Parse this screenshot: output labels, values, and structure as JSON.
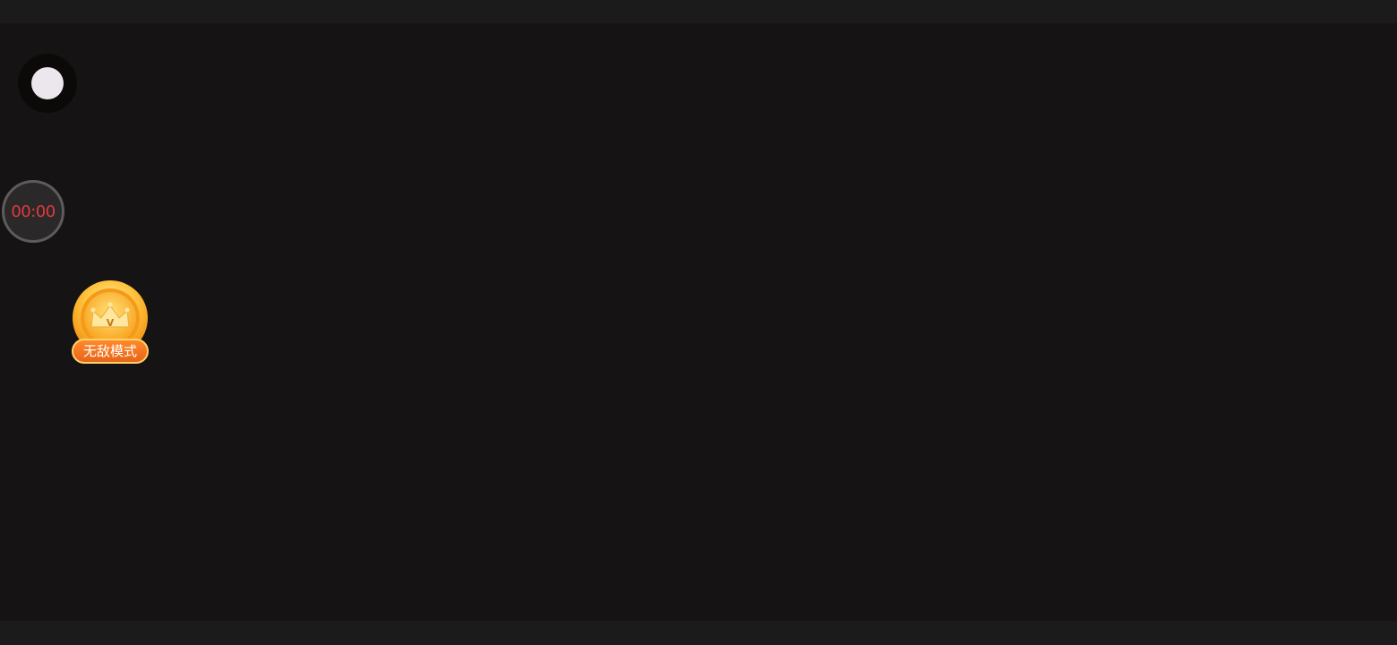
{
  "timer": {
    "value": "00:00"
  },
  "mode_badge": {
    "label": "无敌模式",
    "crown_letter": "V",
    "icon": "crown-coin-icon"
  },
  "record_button": {
    "icon": "record-dot-icon"
  },
  "colors": {
    "background": "#151314",
    "bars": "#1c1b1c",
    "timer_text": "#e03a3e",
    "badge_orange": "#e8641a",
    "coin_gold": "#ffb21f"
  }
}
